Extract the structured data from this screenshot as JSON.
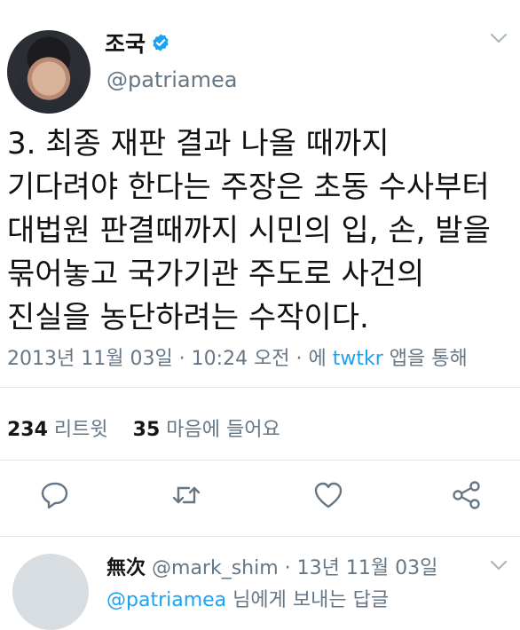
{
  "tweet": {
    "author": {
      "name": "조국",
      "handle": "@patriamea"
    },
    "text_lines": [
      "3. 최종 재판 결과 나올 때까지",
      "기다려야 한다는 주장은 초동 수사부터",
      "대법원 판결때까지 시민의 입, 손, 발을",
      "묶어놓고 국가기관 주도로 사건의",
      "진실을 농단하려는 수작이다."
    ],
    "meta": {
      "date": "2013년 11월 03일",
      "sep1": " · ",
      "time": "10:24 오전",
      "sep2": " · 에 ",
      "via": "twtkr",
      "suffix": " 앱을 통해"
    },
    "stats": {
      "retweets_count": "234",
      "retweets_label": " 리트윗",
      "likes_count": "35",
      "likes_label": " 마음에 들어요"
    }
  },
  "reply": {
    "name": "無次",
    "handle": " @mark_shim",
    "date": " · 13년 11월 03일",
    "to_handle": "@patriamea",
    "to_label": " 님에게 보내는 답글"
  },
  "colors": {
    "accent": "#1da1f2",
    "muted": "#657786"
  }
}
